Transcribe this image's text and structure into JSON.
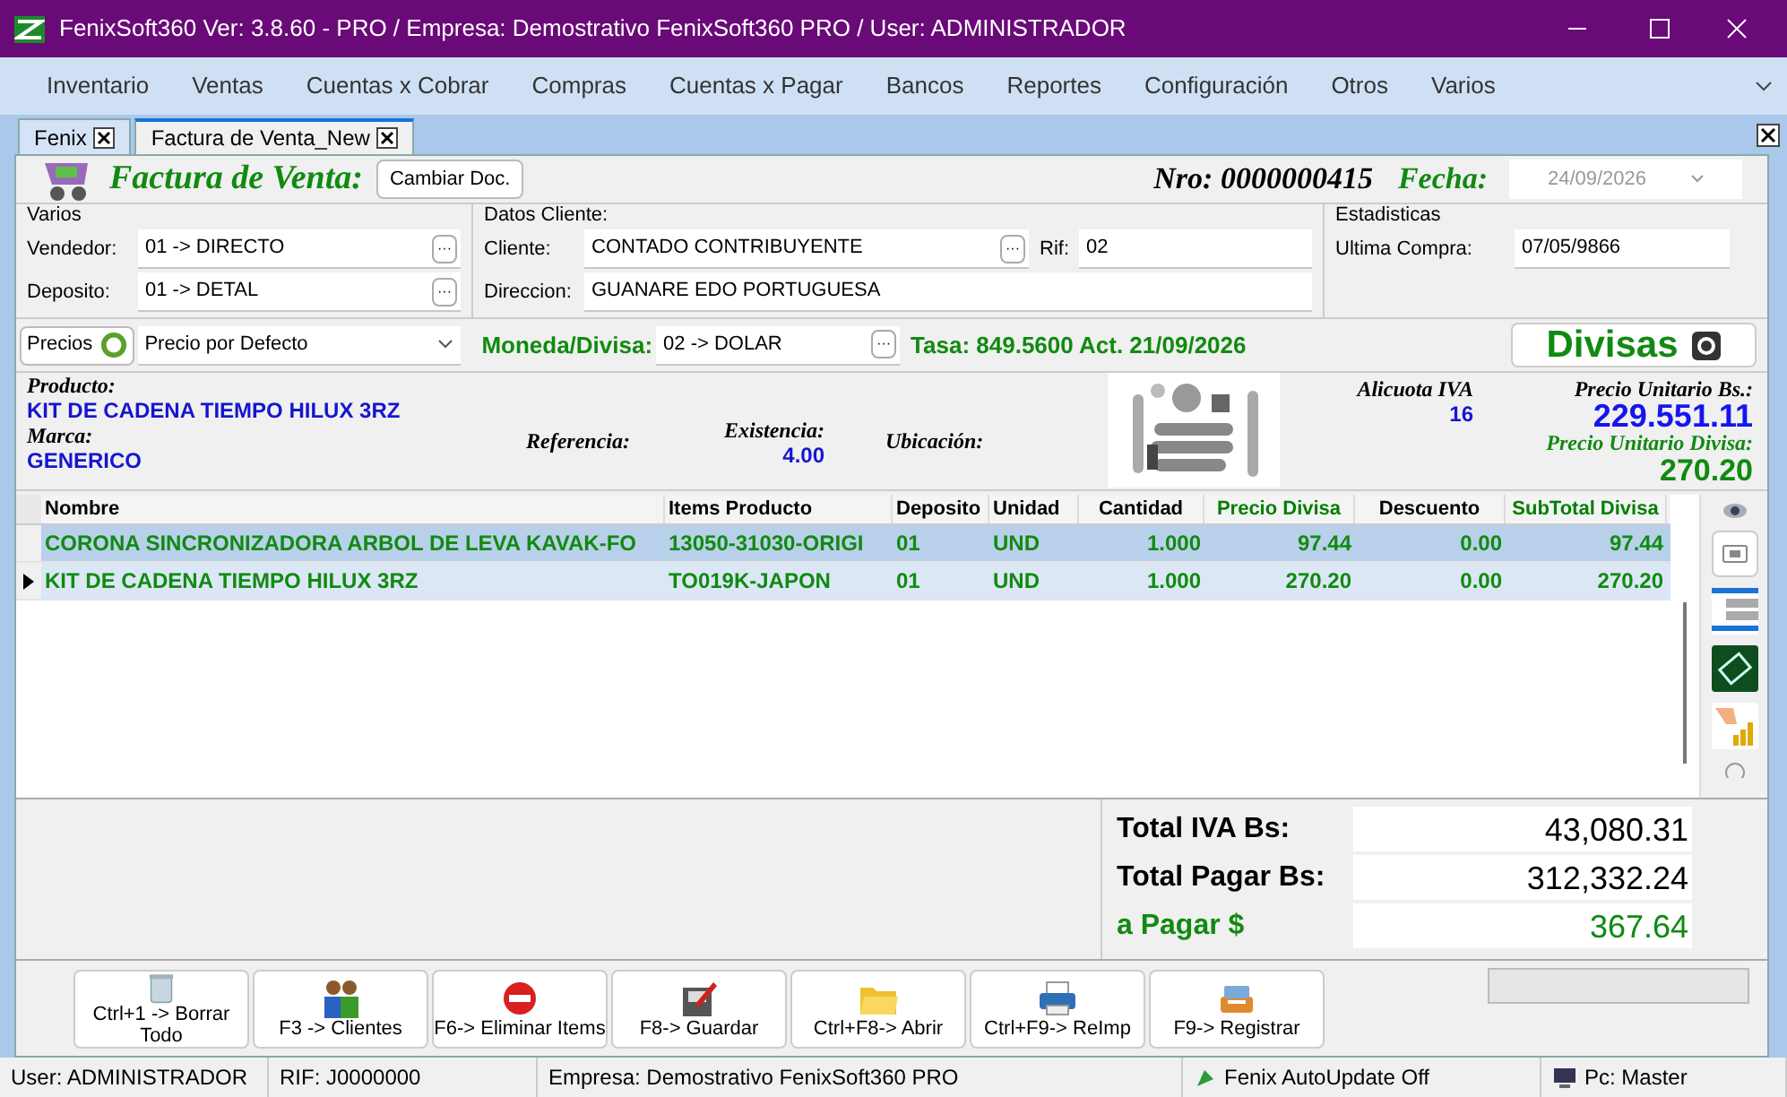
{
  "window": {
    "title": "FenixSoft360 Ver: 3.8.60 - PRO / Empresa: Demostrativo FenixSoft360 PRO / User: ADMINISTRADOR"
  },
  "menu": [
    "Inventario",
    "Ventas",
    "Cuentas x Cobrar",
    "Compras",
    "Cuentas x Pagar",
    "Bancos",
    "Reportes",
    "Configuración",
    "Otros",
    "Varios"
  ],
  "tabs": [
    {
      "label": "Fenix",
      "selected": false
    },
    {
      "label": "Factura de Venta_New",
      "selected": true
    }
  ],
  "header": {
    "title": "Factura de Venta:",
    "change_button": "Cambiar Doc.",
    "nro": "Nro: 0000000415",
    "fecha_label": "Fecha:",
    "fecha": "24/09/2026"
  },
  "varios": {
    "legend": "Varios",
    "fields": [
      {
        "label": "Vendedor:",
        "value": "01 -> DIRECTO",
        "button": "···"
      },
      {
        "label": "Deposito:",
        "value": "01 -> DETAL",
        "button": "···"
      }
    ]
  },
  "cliente": {
    "legend": "Datos Cliente:",
    "cliente_label": "Cliente:",
    "cliente": "CONTADO CONTRIBUYENTE",
    "cliente_button": "···",
    "rif_label": "Rif:",
    "rif": "02",
    "direccion_label": "Direccion:",
    "direccion": "GUANARE EDO PORTUGUESA"
  },
  "estadisticas": {
    "legend": "Estadisticas",
    "label": "Ultima Compra:",
    "value": "07/05/9866"
  },
  "pricing": {
    "precios_button": "Precios",
    "precio": "Precio por Defecto",
    "moneda_label": "Moneda/Divisa:",
    "moneda": "02 -> DOLAR",
    "moneda_button": "···",
    "tasa": "Tasa: 849.5600 Act. 21/09/2026",
    "divisas_button": "Divisas"
  },
  "product": {
    "producto_label": "Producto:",
    "producto": "KIT DE CADENA TIEMPO HILUX 3RZ",
    "marca_label": "Marca:",
    "marca": "GENERICO",
    "referencia_label": "Referencia:",
    "existencia_label": "Existencia:",
    "existencia": "4.00",
    "ubicacion_label": "Ubicación:",
    "alicuota_label": "Alicuota IVA",
    "alicuota": "16",
    "precio_bs_label": "Precio Unitario Bs.:",
    "precio_bs": "229.551.11",
    "precio_divisa_label": "Precio Unitario Divisa:",
    "precio_divisa": "270.20"
  },
  "table": {
    "columns": [
      {
        "label": "Nombre",
        "color": "#000000"
      },
      {
        "label": "Items Producto",
        "color": "#000000"
      },
      {
        "label": "Deposito",
        "color": "#000000"
      },
      {
        "label": "Unidad",
        "color": "#000000"
      },
      {
        "label": "Cantidad",
        "color": "#000000"
      },
      {
        "label": "Precio Divisa",
        "color": "#008000"
      },
      {
        "label": "Descuento",
        "color": "#000000"
      },
      {
        "label": "SubTotal Divisa",
        "color": "#008000"
      }
    ],
    "rows": [
      {
        "selected": true,
        "current": false,
        "cells": [
          "CORONA SINCRONIZADORA ARBOL DE LEVA KAVAK-FO",
          "13050-31030-ORIGI",
          "01",
          "UND",
          "1.000",
          "97.44",
          "0.00",
          "97.44"
        ]
      },
      {
        "selected": false,
        "current": true,
        "cells": [
          "KIT DE CADENA TIEMPO HILUX 3RZ",
          "TO019K-JAPON",
          "01",
          "UND",
          "1.000",
          "270.20",
          "0.00",
          "270.20"
        ]
      }
    ]
  },
  "totals": [
    {
      "label": "Total IVA Bs:",
      "value": "43,080.31",
      "kind": "bs"
    },
    {
      "label": "Total Pagar Bs:",
      "value": "312,332.24",
      "kind": "bs"
    },
    {
      "label": "a Pagar $",
      "value": "367.64",
      "kind": "usd"
    }
  ],
  "toolbar": [
    {
      "label": "Ctrl+1 -> Borrar Todo",
      "kind": "trash"
    },
    {
      "label": "F3 -> Clientes",
      "kind": "people"
    },
    {
      "label": "F6-> Eliminar Items",
      "kind": "stop"
    },
    {
      "label": "F8-> Guardar",
      "kind": "save"
    },
    {
      "label": "Ctrl+F8-> Abrir",
      "kind": "folder"
    },
    {
      "label": "Ctrl+F9-> ReImp",
      "kind": "printer"
    },
    {
      "label": "F9-> Registrar",
      "kind": "register"
    }
  ],
  "status_bar": [
    {
      "text": "User: ADMINISTRADOR",
      "kind": "text"
    },
    {
      "text": "RIF: J0000000",
      "kind": "text"
    },
    {
      "text": "Empresa: Demostrativo FenixSoft360 PRO",
      "kind": "text"
    },
    {
      "text": "Fenix AutoUpdate Off",
      "kind": "update"
    },
    {
      "text": "Pc: Master",
      "kind": "pc"
    }
  ]
}
